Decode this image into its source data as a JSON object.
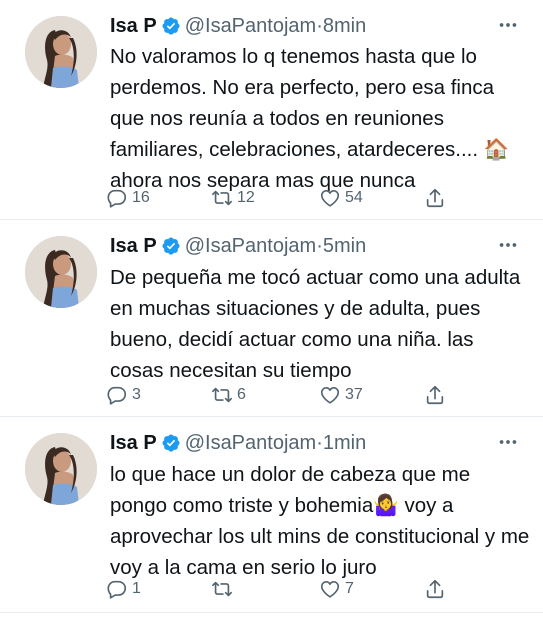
{
  "tweets": [
    {
      "name": "Isa P",
      "handle": "@IsaPantojam",
      "separator": "·",
      "time": "8min",
      "text": "No valoramos lo q tenemos hasta que lo perdemos. No era perfecto, pero esa finca que nos reunía a todos en reuniones familiares, celebraciones, atardeceres.... 🏠 ahora nos separa mas que nunca",
      "replies": "16",
      "retweets": "12",
      "likes": "54"
    },
    {
      "name": "Isa P",
      "handle": "@IsaPantojam",
      "separator": "·",
      "time": "5min",
      "text": "De pequeña me tocó actuar como una adulta en muchas situaciones y de adulta, pues bueno, decidí actuar como una niña. las cosas necesitan su tiempo",
      "replies": "3",
      "retweets": "6",
      "likes": "37"
    },
    {
      "name": "Isa P",
      "handle": "@IsaPantojam",
      "separator": "·",
      "time": "1min",
      "text": "lo que hace un dolor de cabeza que me pongo como triste y bohemia🤷‍♀️ voy a aprovechar los ult mins de constitucional y me voy a la cama en serio lo juro",
      "replies": "1",
      "retweets": "",
      "likes": "7"
    }
  ],
  "icons": {
    "verified": "verified-badge-icon",
    "more": "more-options-icon",
    "reply": "reply-icon",
    "retweet": "retweet-icon",
    "like": "heart-icon",
    "share": "share-icon"
  },
  "colors": {
    "verified": "#1d9bf0",
    "muted": "#536471",
    "text": "#0f1419",
    "divider": "#e6ecf0"
  }
}
